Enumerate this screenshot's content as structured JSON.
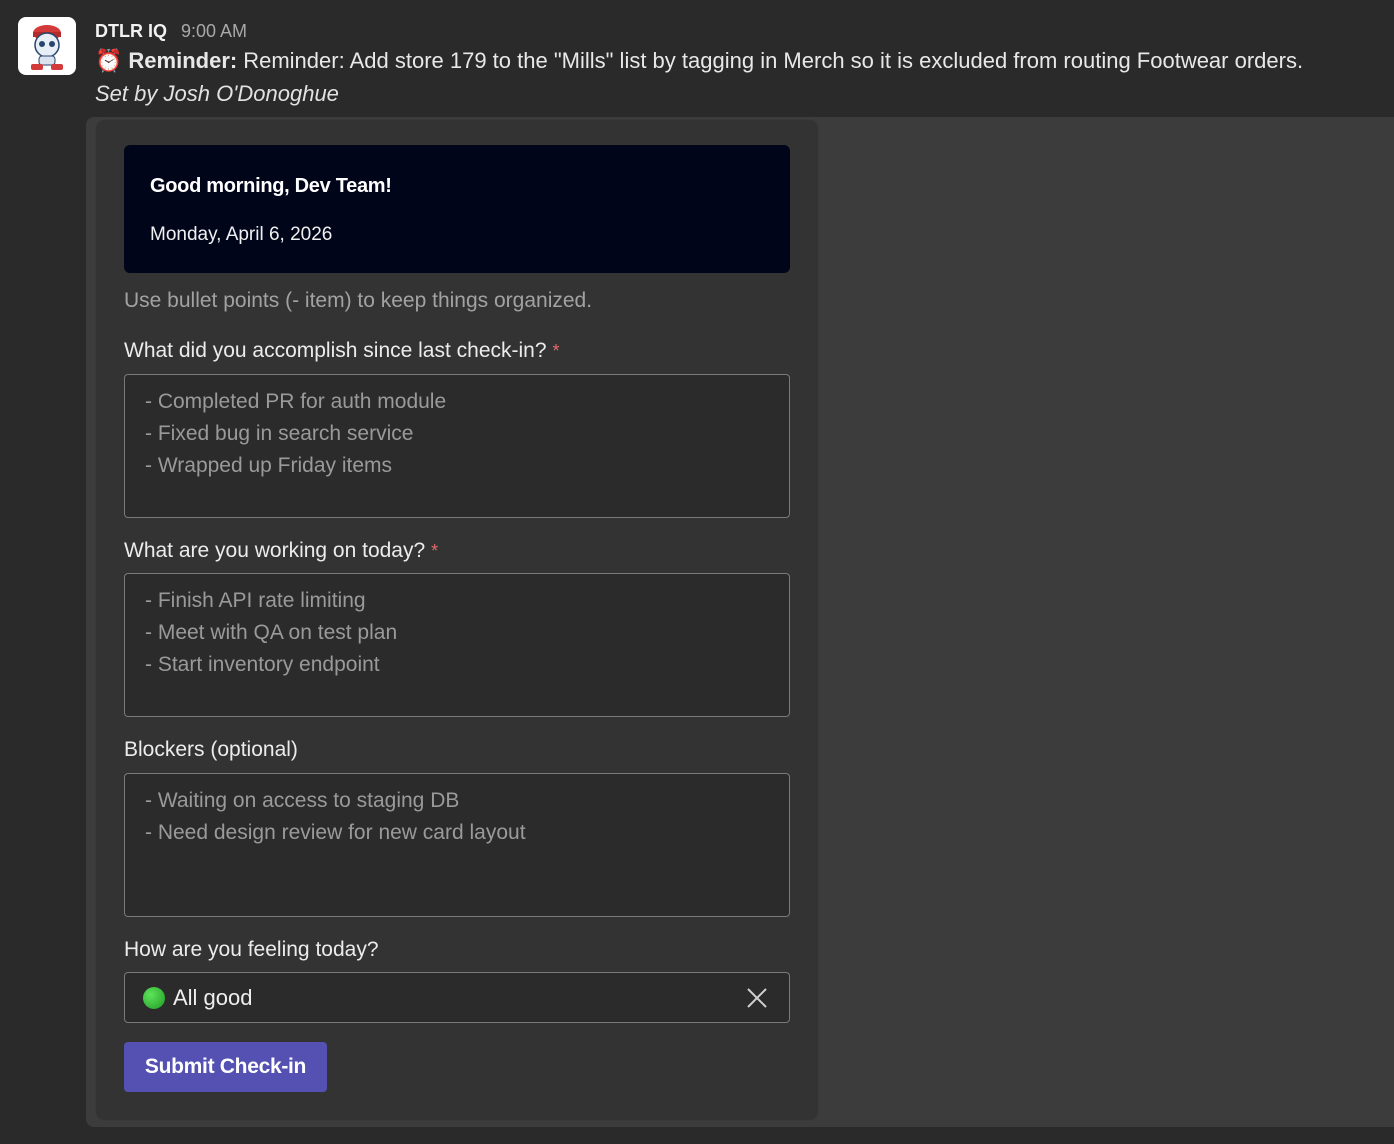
{
  "message": {
    "sender": "DTLR IQ",
    "time": "9:00 AM",
    "reminder_icon": "alarm-clock-icon",
    "reminder_bold": "Reminder:",
    "reminder_text": "Reminder: Add store 179 to the \"Mills\" list by tagging in Merch so it is excluded from routing Footwear orders.",
    "set_by": "Set by Josh O'Donoghue"
  },
  "banner": {
    "title": "Good morning, Dev Team!",
    "date": "Monday, April 6, 2026"
  },
  "form": {
    "hint": "Use bullet points (- item) to keep things organized.",
    "accomplished": {
      "label": "What did you accomplish since last check-in?",
      "required_mark": "*",
      "placeholder_lines": [
        "- Completed PR for auth module",
        "- Fixed bug in search service",
        "- Wrapped up Friday items"
      ]
    },
    "today": {
      "label": "What are you working on today?",
      "required_mark": "*",
      "placeholder_lines": [
        "- Finish API rate limiting",
        "- Meet with QA on test plan",
        "- Start inventory endpoint"
      ]
    },
    "blockers": {
      "label": "Blockers (optional)",
      "placeholder_lines": [
        "- Waiting on access to staging DB",
        "- Need design review for new card layout"
      ]
    },
    "feeling": {
      "label": "How are you feeling today?",
      "selected": "All good",
      "status_color": "#2ecc40"
    },
    "submit_label": "Submit Check-in"
  },
  "colors": {
    "banner_bg": "#01051a",
    "button_bg": "#5451b3",
    "required": "#e26b6b"
  }
}
